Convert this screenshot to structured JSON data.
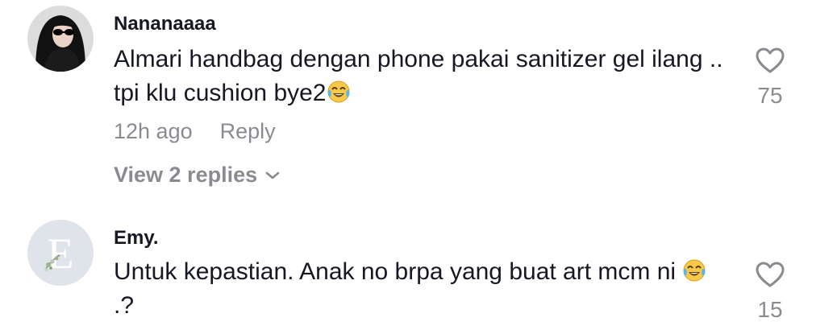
{
  "comments": [
    {
      "username": "Nananaaaa",
      "text": "Almari handbag dengan phone pakai sanitizer gel ilang .. tpi klu cushion bye2",
      "text_suffix": "",
      "time": "12h ago",
      "reply_label": "Reply",
      "replies_label": "View 2 replies",
      "likes": "75",
      "avatar_icon": "user-avatar-sunglasses"
    },
    {
      "username": "Emy.",
      "text": "Untuk kepastian. Anak no brpa yang buat art mcm ni",
      "text_suffix": ".?",
      "likes": "15",
      "avatar_icon": "letter-e-floral-avatar"
    }
  ],
  "colors": {
    "text_primary": "#161823",
    "text_secondary": "rgba(22,24,35,0.5)",
    "heart_outline": "#8a8b91"
  }
}
